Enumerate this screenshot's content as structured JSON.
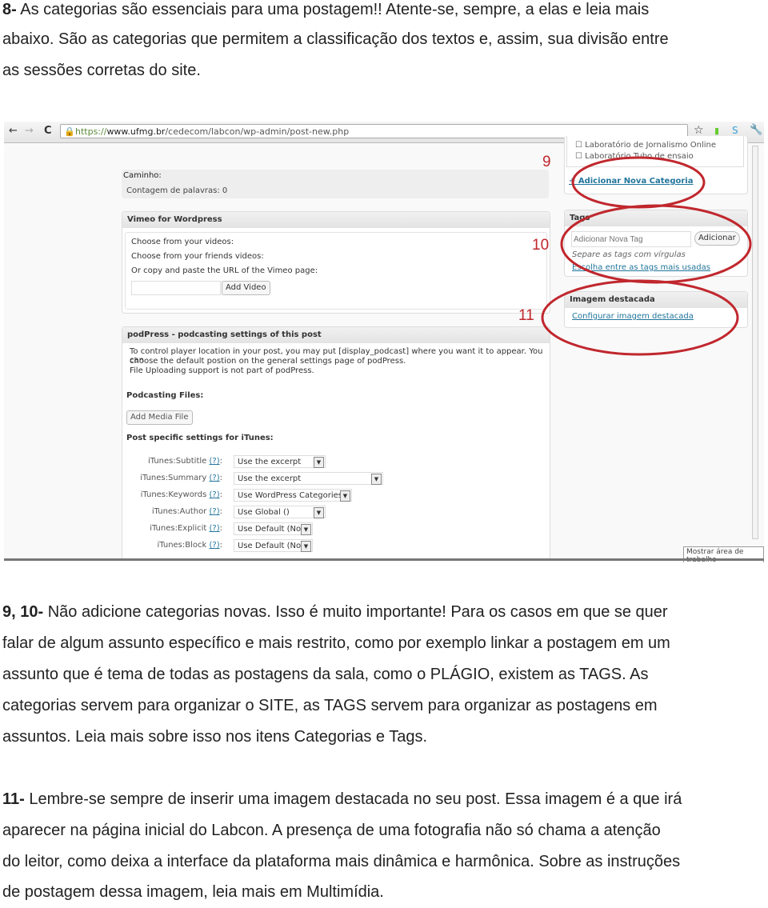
{
  "intro": {
    "num": "8-",
    "lines": [
      "As categorias são essenciais para uma postagem!! Atente-se, sempre, a elas e leia mais",
      "abaixo. São as categorias que permitem a classificação dos textos e, assim, sua divisão entre",
      "as sessões corretas do site."
    ]
  },
  "browser": {
    "url_scheme": "https://",
    "url_host": "www.ufmg.br",
    "url_path": "/cedecom/labcon/wp-admin/post-new.php"
  },
  "editor": {
    "path_label": "Caminho:",
    "word_count": "Contagem de palavras: 0"
  },
  "vimeo": {
    "title": "Vimeo for Wordpress",
    "line1": "Choose from your videos:",
    "line2": "Choose from your friends videos:",
    "line3": "Or copy and paste the URL of the Vimeo page:",
    "url_value": "",
    "add_button": "Add Video"
  },
  "podpress": {
    "title": "podPress - podcasting settings of this post",
    "desc1": "To control player location in your post, you may put [display_podcast] where you want it to appear. You can",
    "desc2": "choose the default postion on the general settings page of podPress.",
    "desc3": "File Uploading support is not part of podPress.",
    "files_label": "Podcasting Files:",
    "add_media": "Add Media File",
    "itunes_label": "Post specific settings for iTunes:",
    "help": "(?)",
    "rows": [
      {
        "label": "iTunes:Subtitle",
        "value": "Use the excerpt"
      },
      {
        "label": "iTunes:Summary",
        "value": "Use the excerpt"
      },
      {
        "label": "iTunes:Keywords",
        "value": "Use WordPress Categories"
      },
      {
        "label": "iTunes:Author",
        "value": "Use Global ()"
      },
      {
        "label": "iTunes:Explicit",
        "value": "Use Default (No)"
      },
      {
        "label": "iTunes:Block",
        "value": "Use Default (No)"
      }
    ]
  },
  "categories": {
    "items": [
      "Laboratório de Jornalismo Online",
      "Laboratório Tubo de ensaio"
    ],
    "add_link": "+ Adicionar Nova Categoria"
  },
  "tags": {
    "title": "Tags",
    "placeholder": "Adicionar Nova Tag",
    "add_button": "Adicionar",
    "hint": "Separe as tags com vírgulas",
    "choose_link": "Escolha entre as tags mais usadas"
  },
  "featured": {
    "title": "Imagem destacada",
    "link": "Configurar imagem destacada"
  },
  "tooltip": "Mostrar área de trabalho",
  "annotations": {
    "n9": "9",
    "n10": "10",
    "n11": "11",
    "color": "#c0272d"
  },
  "body": {
    "p1_num": "9, 10-",
    "p1": [
      "Não adicione categorias novas. Isso é muito importante! Para os casos em que se quer",
      "falar de algum assunto específico e mais restrito, como por exemplo linkar a postagem em um",
      "assunto que é tema de todas as postagens da sala, como o PLÁGIO, existem as TAGS. As",
      "categorias servem para organizar o SITE, as TAGS servem para organizar as postagens em",
      "assuntos. Leia mais sobre isso nos itens Categorias e Tags."
    ],
    "p2_num": "11-",
    "p2": [
      "Lembre-se sempre de inserir uma imagem destacada no seu post. Essa imagem é a que irá",
      "aparecer na página inicial do Labcon. A presença de uma fotografia não só chama a atenção",
      "do leitor, como deixa a interface da plataforma mais dinâmica e harmônica. Sobre as instruções",
      "de postagem dessa imagem, leia mais em Multimídia."
    ]
  }
}
